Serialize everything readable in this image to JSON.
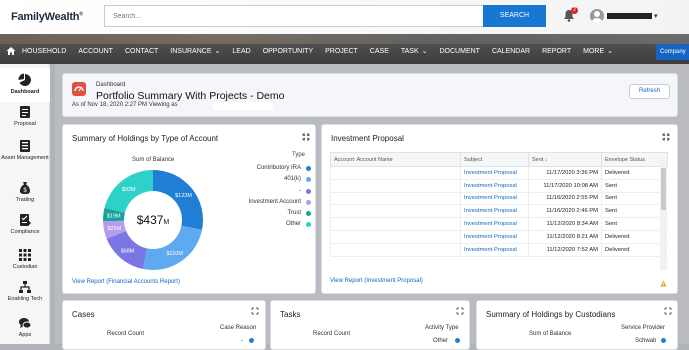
{
  "header": {
    "logo": "FamilyWealth",
    "logo_mark": "®",
    "search_placeholder": "Search...",
    "search_button": "SEARCH",
    "notification_count": "2"
  },
  "nav": {
    "items": [
      "HOUSEHOLD",
      "ACCOUNT",
      "CONTACT",
      "INSURANCE",
      "LEAD",
      "OPPORTUNITY",
      "PROJECT",
      "CASE",
      "TASK",
      "DOCUMENT",
      "CALENDAR",
      "REPORT",
      "MORE"
    ],
    "company_button": "Company"
  },
  "sidebar": {
    "items": [
      {
        "label": "Dashboard",
        "icon": "pie-chart-icon"
      },
      {
        "label": "Proposal",
        "icon": "document-icon"
      },
      {
        "label": "Asset Management",
        "icon": "document-lines-icon"
      },
      {
        "label": "Trading",
        "icon": "money-bag-icon"
      },
      {
        "label": "Compliance",
        "icon": "checklist-icon"
      },
      {
        "label": "Custodian",
        "icon": "grid-icon"
      },
      {
        "label": "Enabling Tech",
        "icon": "network-icon"
      },
      {
        "label": "Apps",
        "icon": "chat-bubbles-icon"
      }
    ]
  },
  "dashboard": {
    "kicker": "Dashboard",
    "title": "Portfolio Summary With Projects - Demo",
    "subtitle": "As of Nov 18, 2020 2:27 PM Viewing as",
    "refresh": "Refresh"
  },
  "holdings_card": {
    "title": "Summary of Holdings by Type of Account",
    "sum_label": "Sum of Balance",
    "center_value": "$437",
    "center_unit": "M",
    "legend_title": "Type",
    "report_link": "View Report (Financial Accounts Report)"
  },
  "chart_data": {
    "type": "pie",
    "center_total": "$437M",
    "legend": [
      "Contributory IRA",
      "401(k)",
      "-",
      "Investment Account",
      "Trust",
      "Other"
    ],
    "colors": [
      "#1f7fd4",
      "#5ea9f0",
      "#7a76e6",
      "#b79bec",
      "#17a39b",
      "#2ed1c7"
    ],
    "slice_labels": [
      "$123M",
      "$110M",
      "$68M",
      "$25M",
      "$19M",
      "$92M"
    ],
    "values": [
      123,
      110,
      68,
      25,
      19,
      92
    ]
  },
  "proposal_card": {
    "title": "Investment Proposal",
    "columns": [
      "Account: Account Name",
      "Subject",
      "Sent ↓",
      "Envelope Status"
    ],
    "rows": [
      {
        "account": "",
        "subject": "Investment Proposal",
        "sent": "11/17/2020 3:36 PM",
        "status": "Delivered"
      },
      {
        "account": "",
        "subject": "Investment Proposal",
        "sent": "11/17/2020 10:08 AM",
        "status": "Sent"
      },
      {
        "account": "",
        "subject": "Investment Proposal",
        "sent": "11/16/2020 2:55 PM",
        "status": "Sent"
      },
      {
        "account": "",
        "subject": "Investment Proposal",
        "sent": "11/16/2020 2:46 PM",
        "status": "Sent"
      },
      {
        "account": "",
        "subject": "Investment Proposal",
        "sent": "11/12/2020 8:34 AM",
        "status": "Sent"
      },
      {
        "account": "",
        "subject": "Investment Proposal",
        "sent": "11/12/2020 8:21 AM",
        "status": "Delivered"
      },
      {
        "account": "",
        "subject": "Investment Proposal",
        "sent": "11/12/2020 7:52 AM",
        "status": "Delivered"
      }
    ],
    "report_link": "View Report (Investment Proposal)"
  },
  "cases_card": {
    "title": "Cases",
    "left_label": "Record Count",
    "right_label": "Case Reason",
    "value": "-"
  },
  "tasks_card": {
    "title": "Tasks",
    "left_label": "Record Count",
    "right_label": "Activity Type",
    "value": "Other"
  },
  "custodians_card": {
    "title": "Summary of Holdings by Custodians",
    "left_label": "Sum of Balance",
    "right_label": "Service Provider",
    "value": "Schwab"
  }
}
